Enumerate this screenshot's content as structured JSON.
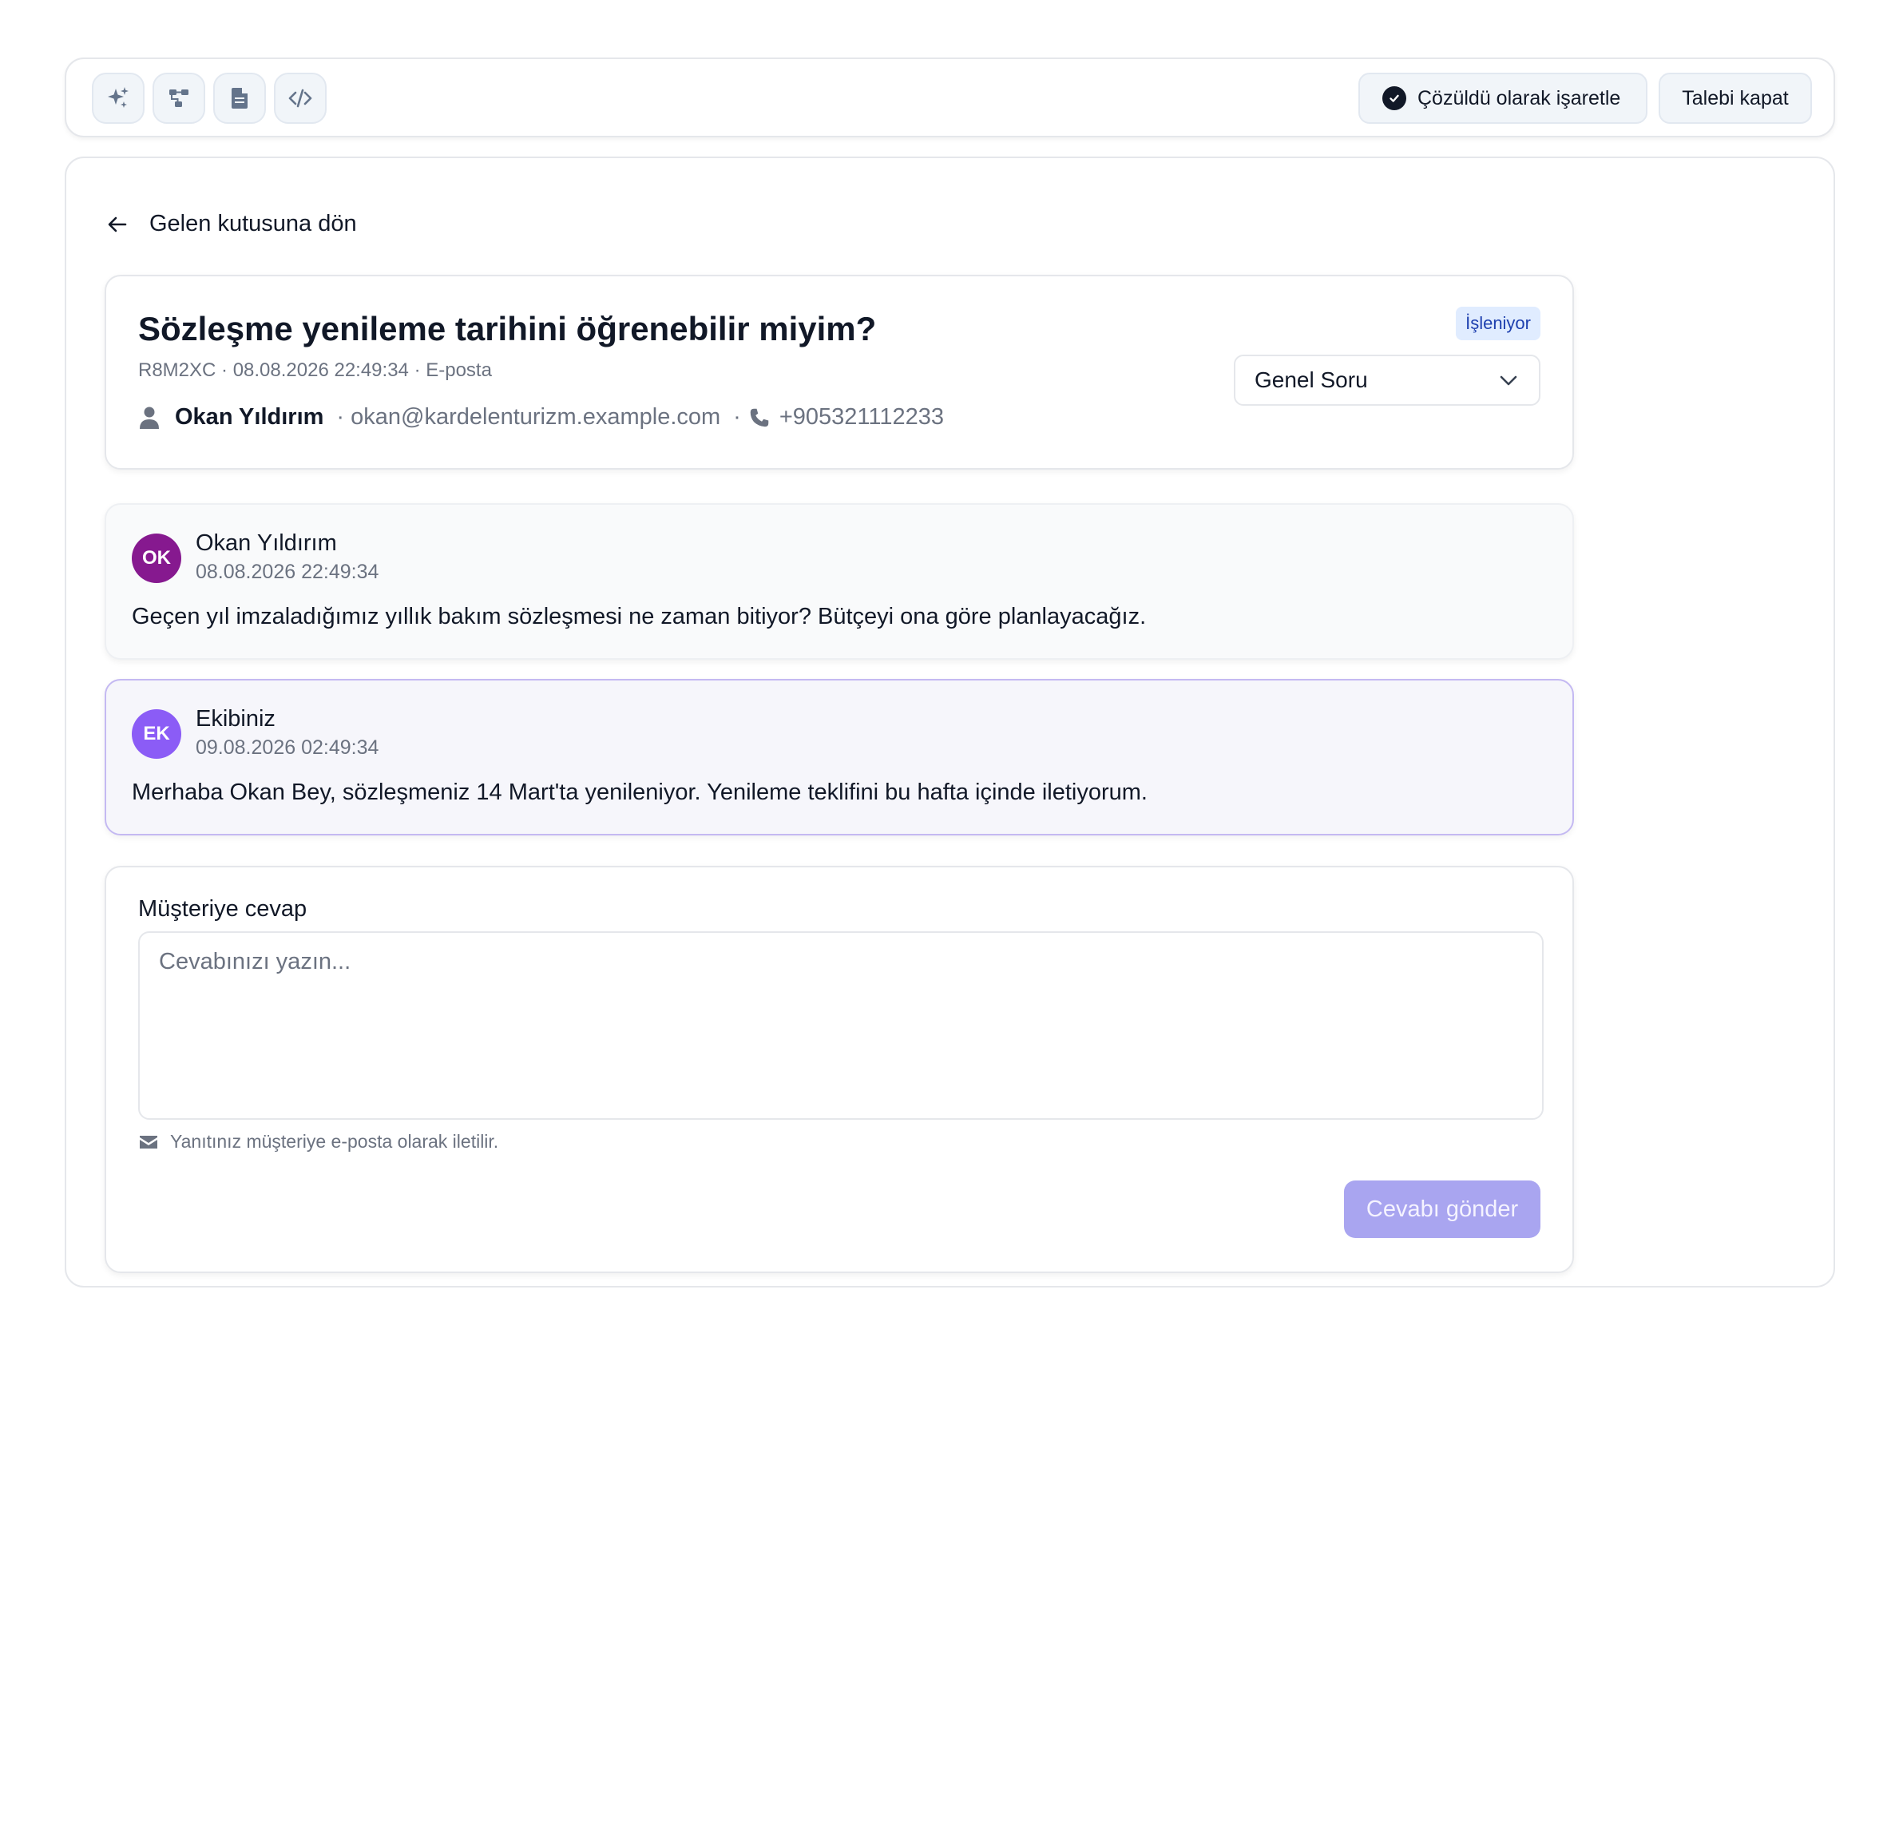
{
  "toolbar": {
    "tools": [
      {
        "icon": "sparkles-icon"
      },
      {
        "icon": "workflow-icon"
      },
      {
        "icon": "document-icon"
      },
      {
        "icon": "code-icon"
      }
    ],
    "resolve_label": "Çözüldü olarak işaretle",
    "close_label": "Talebi kapat"
  },
  "back_label": "Gelen kutusuna dön",
  "ticket": {
    "title": "Sözleşme yenileme tarihini öğrenebilir miyim?",
    "meta": "R8M2XC · 08.08.2026 22:49:34 · E-posta",
    "contact_name": "Okan Yıldırım",
    "contact_email": "· okan@kardelenturizm.example.com",
    "contact_sep": "·",
    "contact_phone": "+905321112233",
    "status": "İşleniyor",
    "category": "Genel Soru"
  },
  "messages": [
    {
      "initials": "OK",
      "name": "Okan Yıldırım",
      "time": "08.08.2026 22:49:34",
      "body": "Geçen yıl imzaladığımız yıllık bakım sözleşmesi ne zaman bitiyor? Bütçeyi ona göre planlayacağız.",
      "avatar_color": "#86198f"
    },
    {
      "initials": "EK",
      "name": "Ekibiniz",
      "time": "09.08.2026 02:49:34",
      "body": "Merhaba Okan Bey, sözleşmeniz 14 Mart'ta yenileniyor. Yenileme teklifini bu hafta içinde iletiyorum.",
      "avatar_color": "#8b5cf6"
    }
  ],
  "reply": {
    "label": "Müşteriye cevap",
    "placeholder": "Cevabınızı yazın...",
    "value": "",
    "note": "Yanıtınız müşteriye e-posta olarak iletilir.",
    "send_label": "Cevabı gönder"
  },
  "colors": {
    "accent": "#a9a5f0",
    "status_bg": "#e0ecff",
    "status_text": "#1e40af"
  }
}
